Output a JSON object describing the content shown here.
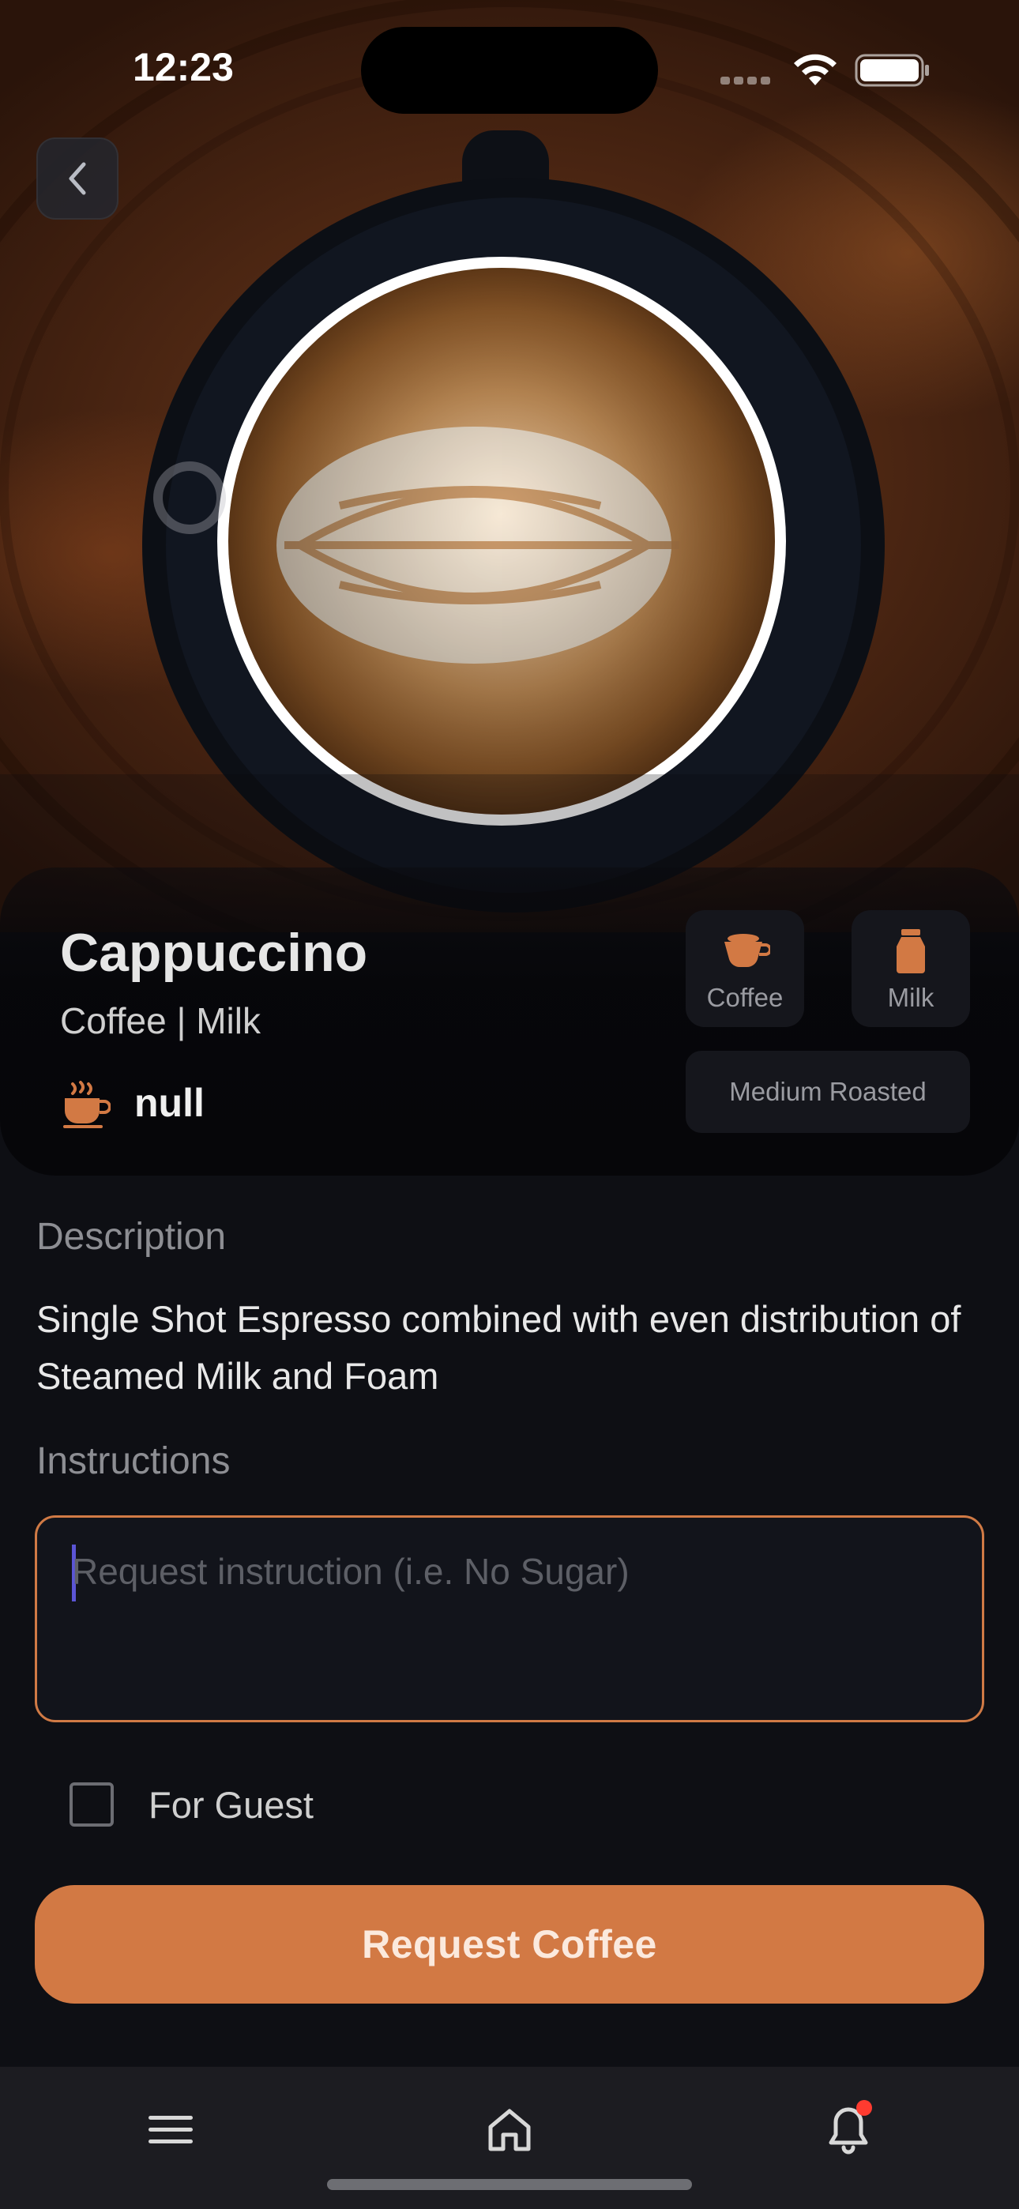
{
  "status_bar": {
    "time": "12:23"
  },
  "hero": {
    "image_alt": "Cappuccino latte art"
  },
  "navigation": {
    "back_icon": "chevron-left-icon"
  },
  "product": {
    "name": "Cappuccino",
    "subtitle": "Coffee | Milk",
    "roast_value": "null",
    "tags": [
      {
        "label": "Coffee",
        "icon": "coffee-cup-icon"
      },
      {
        "label": "Milk",
        "icon": "milk-bottle-icon"
      }
    ],
    "roast_chip": "Medium Roasted"
  },
  "description": {
    "label": "Description",
    "text": "Single Shot Espresso combined with even distribution of Steamed Milk and Foam"
  },
  "instructions": {
    "label": "Instructions",
    "placeholder": "Request instruction (i.e. No Sugar)",
    "value": ""
  },
  "guest": {
    "label": "For Guest",
    "checked": false
  },
  "actions": {
    "request_label": "Request Coffee"
  },
  "bottom_nav": {
    "items": [
      {
        "name": "menu",
        "icon": "hamburger-menu-icon"
      },
      {
        "name": "home",
        "icon": "home-icon"
      },
      {
        "name": "notifications",
        "icon": "bell-icon",
        "has_badge": true
      }
    ]
  },
  "colors": {
    "accent": "#d27944",
    "background": "#0e0f14",
    "card": "#15161c",
    "notification_badge": "#ff3b30"
  }
}
